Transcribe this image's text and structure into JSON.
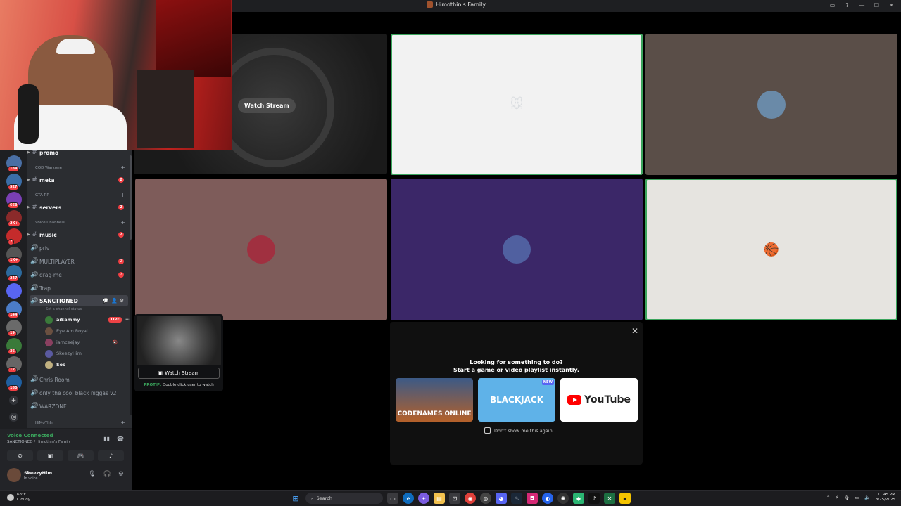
{
  "window": {
    "title": "Himothin's Family"
  },
  "stage": {
    "watch_stream_label": "Watch Stream"
  },
  "activity_panel": {
    "heading_line1": "Looking for something to do?",
    "heading_line2": "Start a game or video playlist instantly.",
    "cards": [
      {
        "name": "CODENAMES ONLINE"
      },
      {
        "name": "BLACKJACK",
        "badge": "NEW"
      },
      {
        "name": "YouTube"
      }
    ],
    "dont_show_label": "Don't show me this again."
  },
  "stream_preview": {
    "watch_label": "Watch Stream",
    "protip_label": "PROTIP:",
    "protip_text": "Double click user to watch"
  },
  "servers": [
    {
      "count": "184",
      "color": "#4a6fa5"
    },
    {
      "count": "527",
      "color": "#3b6ea8"
    },
    {
      "count": "663",
      "color": "#7a3fb5"
    },
    {
      "count": "2K+",
      "color": "#8a2a2a"
    },
    {
      "count": "7",
      "color": "#c42b2b"
    },
    {
      "count": "1K+",
      "color": "#555"
    },
    {
      "count": "247",
      "color": "#2c6a9e"
    },
    {
      "count": "",
      "color": "#5865f2"
    },
    {
      "count": "144",
      "color": "#4b7cc7"
    },
    {
      "count": "19",
      "color": "#6a6a6a"
    },
    {
      "count": "36",
      "color": "#3a7a3a"
    },
    {
      "count": "12",
      "color": "#666"
    },
    {
      "count": "160",
      "color": "#1f5fa0"
    }
  ],
  "channels": {
    "top_channel": "promo",
    "categories": [
      {
        "name": "COD Warzone",
        "channels": [
          {
            "name": "meta",
            "unread": true,
            "mentions": "2"
          }
        ]
      },
      {
        "name": "GTA RP",
        "channels": [
          {
            "name": "servers",
            "unread": true,
            "mentions": "2"
          }
        ]
      },
      {
        "name": "Voice Channels",
        "channels": [
          {
            "name": "music",
            "unread": true,
            "mentions": "2"
          }
        ]
      }
    ],
    "voice": [
      {
        "name": "priv",
        "mentions": ""
      },
      {
        "name": "MULTIPLAYER",
        "mentions": "2"
      },
      {
        "name": "drag-me",
        "mentions": "2"
      },
      {
        "name": "Trap",
        "mentions": ""
      }
    ],
    "active_voice": {
      "name": "SANCTIONED",
      "status_placeholder": "Set a channel status",
      "users": [
        {
          "name": "aiSammy",
          "live": "LIVE",
          "color": "#3a7a3a",
          "strong": true
        },
        {
          "name": "Eye Am Royal",
          "live": "",
          "color": "#6a5040",
          "strong": false
        },
        {
          "name": "iamceejay.",
          "live": "",
          "color": "#8a4060",
          "strong": false
        },
        {
          "name": "SkeezyHim",
          "live": "",
          "color": "#5a5aa0",
          "strong": false
        },
        {
          "name": "Sos",
          "live": "",
          "color": "#c0b080",
          "strong": true
        }
      ]
    },
    "more_voice": [
      "Chris Room",
      "only the cool black niggas v2",
      "WARZONE"
    ],
    "last_category": "HiMoThIn"
  },
  "voice_connected": {
    "title": "Voice Connected",
    "subtitle": "SANCTIONED / Himothin's Family"
  },
  "user": {
    "name": "SkeezyHim",
    "status": "In voice"
  },
  "taskbar": {
    "temp": "68°F",
    "condition": "Cloudy",
    "search": "Search",
    "time": "11:45 PM",
    "date": "8/25/2025"
  }
}
